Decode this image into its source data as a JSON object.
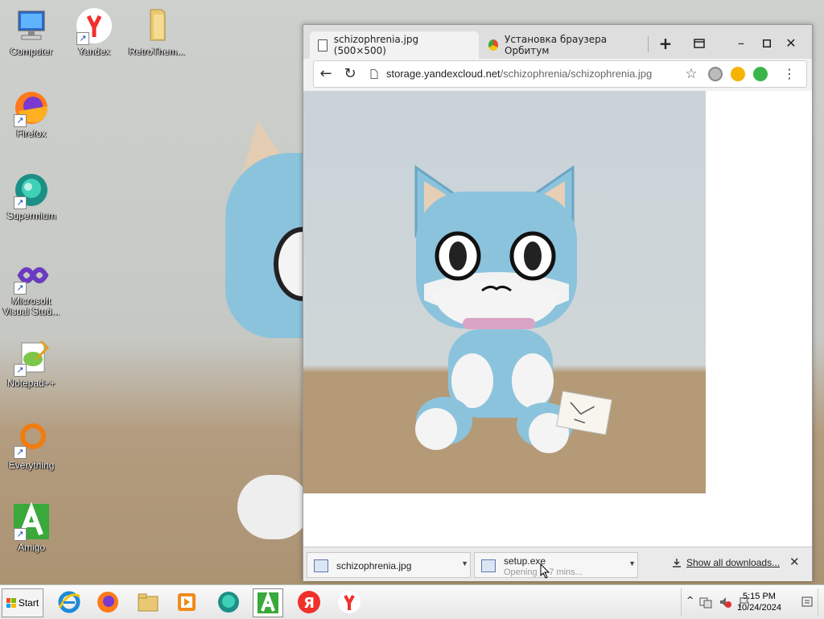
{
  "desktop": {
    "icons": [
      {
        "label": "Computer",
        "icon": "computer-icon"
      },
      {
        "label": "Yandex",
        "icon": "yandex-icon"
      },
      {
        "label": "RetroThem...",
        "icon": "folder-icon"
      },
      {
        "label": "Firefox",
        "icon": "firefox-icon"
      },
      {
        "label": "Supermium",
        "icon": "supermium-icon"
      },
      {
        "label": "Microsoft Visual Stud...",
        "icon": "visual-studio-icon"
      },
      {
        "label": "Notepad++",
        "icon": "notepad-plus-plus-icon"
      },
      {
        "label": "Everything",
        "icon": "everything-search-icon"
      },
      {
        "label": "Amigo",
        "icon": "amigo-icon"
      }
    ]
  },
  "browser": {
    "tabs": [
      {
        "title": "schizophrenia.jpg (500×500)",
        "active": true
      },
      {
        "title": "Установка браузера Орбитум",
        "active": false
      }
    ],
    "url_host": "storage.yandexcloud.net",
    "url_path": "/schizophrenia/schizophrenia.jpg",
    "downloads": [
      {
        "name": "schizophrenia.jpg",
        "status": ""
      },
      {
        "name": "setup.exe",
        "status": "Opening in 7 mins..."
      }
    ],
    "show_all_label": "Show all downloads..."
  },
  "taskbar": {
    "start_label": "Start",
    "apps": [
      "internet-explorer",
      "firefox",
      "file-explorer",
      "media-player",
      "supermium",
      "amigo",
      "yandex-ya",
      "yandex-browser"
    ],
    "time": "5:15 PM",
    "date": "10/24/2024"
  },
  "colors": {
    "plush_blue": "#8cc3dc",
    "amigo_green": "#3aa83a",
    "yandex_red": "#f0302a"
  }
}
